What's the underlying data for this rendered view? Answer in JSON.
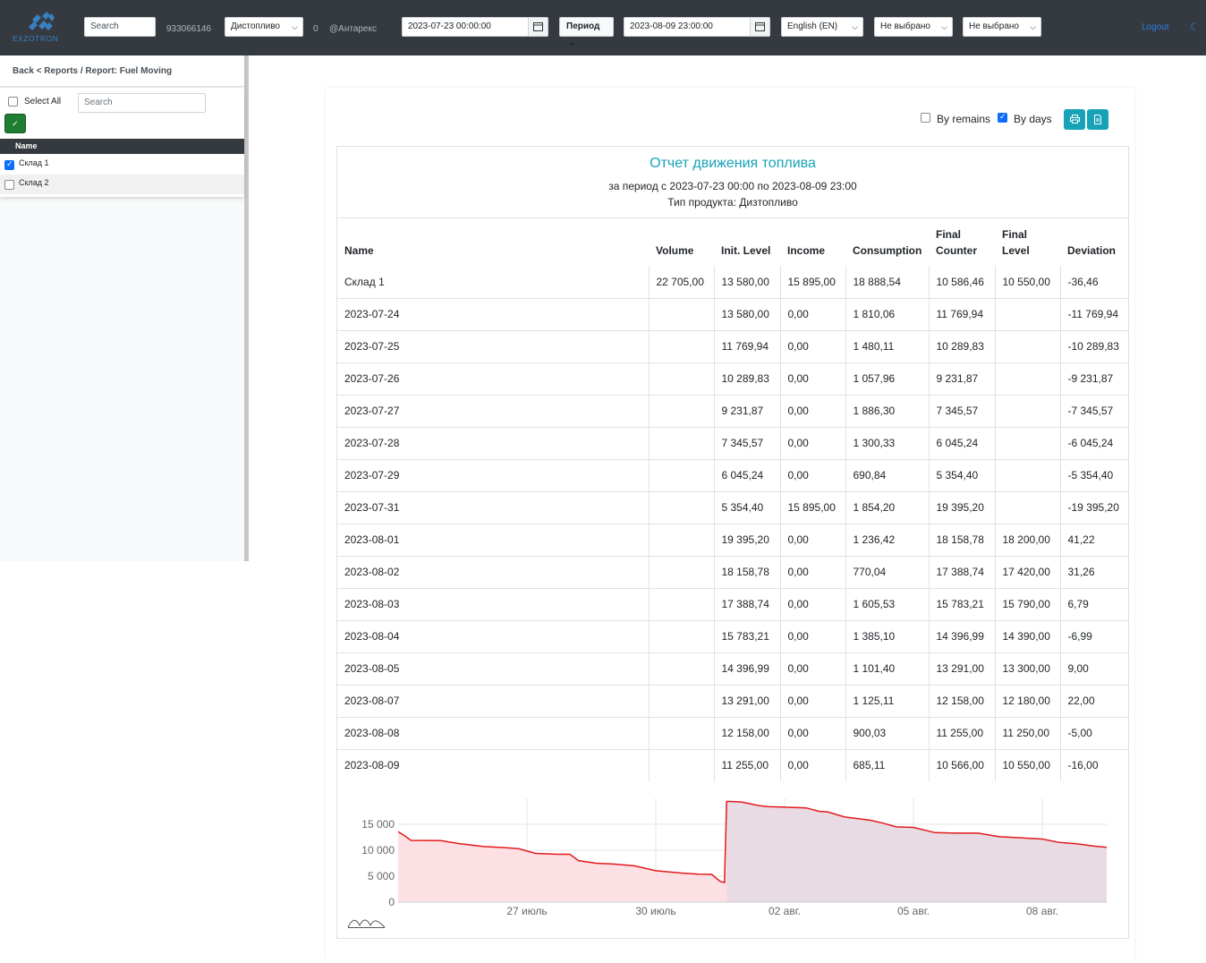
{
  "navbar": {
    "logo_text": "EXZOTRON",
    "search_placeholder": "Search",
    "phone": "933066146",
    "product_select": "Дистопливо",
    "count": "0",
    "company": "@Антарекс",
    "date_from": "2023-07-23 00:00:00",
    "period_button": "Период",
    "date_to": "2023-08-09 23:00:00",
    "language_select": "English (EN)",
    "filter1_select": "Не выбрано",
    "filter2_select": "Не выбрано",
    "logout": "Logout"
  },
  "sidebar": {
    "breadcrumb": "Back < Reports / Report: Fuel Moving",
    "select_all_label": "Select All",
    "search_placeholder": "Search",
    "column_header": "Name",
    "items": [
      {
        "label": "Склад 1",
        "checked": true
      },
      {
        "label": "Склад 2",
        "checked": false
      }
    ]
  },
  "options": {
    "by_remains_label": "By remains",
    "by_remains_checked": false,
    "by_days_label": "By days",
    "by_days_checked": true,
    "print_icon": "printer-icon",
    "export_icon": "file-excel-icon"
  },
  "report": {
    "title": "Отчет движения топлива",
    "period": "за период с 2023-07-23 00:00 по 2023-08-09 23:00",
    "product": "Тип продукта: Дизтопливо",
    "columns": [
      "Name",
      "Volume",
      "Init. Level",
      "Income",
      "Consumption",
      "Final Counter",
      "Final Level",
      "Deviation"
    ],
    "rows": [
      [
        "Склад 1",
        "22 705,00",
        "13 580,00",
        "15 895,00",
        "18 888,54",
        "10 586,46",
        "10 550,00",
        "-36,46"
      ],
      [
        "2023-07-24",
        "",
        "13 580,00",
        "0,00",
        "1 810,06",
        "11 769,94",
        "",
        "-11 769,94"
      ],
      [
        "2023-07-25",
        "",
        "11 769,94",
        "0,00",
        "1 480,11",
        "10 289,83",
        "",
        "-10 289,83"
      ],
      [
        "2023-07-26",
        "",
        "10 289,83",
        "0,00",
        "1 057,96",
        "9 231,87",
        "",
        "-9 231,87"
      ],
      [
        "2023-07-27",
        "",
        "9 231,87",
        "0,00",
        "1 886,30",
        "7 345,57",
        "",
        "-7 345,57"
      ],
      [
        "2023-07-28",
        "",
        "7 345,57",
        "0,00",
        "1 300,33",
        "6 045,24",
        "",
        "-6 045,24"
      ],
      [
        "2023-07-29",
        "",
        "6 045,24",
        "0,00",
        "690,84",
        "5 354,40",
        "",
        "-5 354,40"
      ],
      [
        "2023-07-31",
        "",
        "5 354,40",
        "15 895,00",
        "1 854,20",
        "19 395,20",
        "",
        "-19 395,20"
      ],
      [
        "2023-08-01",
        "",
        "19 395,20",
        "0,00",
        "1 236,42",
        "18 158,78",
        "18 200,00",
        "41,22"
      ],
      [
        "2023-08-02",
        "",
        "18 158,78",
        "0,00",
        "770,04",
        "17 388,74",
        "17 420,00",
        "31,26"
      ],
      [
        "2023-08-03",
        "",
        "17 388,74",
        "0,00",
        "1 605,53",
        "15 783,21",
        "15 790,00",
        "6,79"
      ],
      [
        "2023-08-04",
        "",
        "15 783,21",
        "0,00",
        "1 385,10",
        "14 396,99",
        "14 390,00",
        "-6,99"
      ],
      [
        "2023-08-05",
        "",
        "14 396,99",
        "0,00",
        "1 101,40",
        "13 291,00",
        "13 300,00",
        "9,00"
      ],
      [
        "2023-08-07",
        "",
        "13 291,00",
        "0,00",
        "1 125,11",
        "12 158,00",
        "12 180,00",
        "22,00"
      ],
      [
        "2023-08-08",
        "",
        "12 158,00",
        "0,00",
        "900,03",
        "11 255,00",
        "11 250,00",
        "-5,00"
      ],
      [
        "2023-08-09",
        "",
        "11 255,00",
        "0,00",
        "685,11",
        "10 566,00",
        "10 550,00",
        "-16,00"
      ]
    ]
  },
  "chart_data": {
    "type": "area",
    "ylim": [
      0,
      20000
    ],
    "yticks": [
      0,
      5000,
      10000,
      15000
    ],
    "ytick_labels": [
      "0",
      "5 000",
      "10 000",
      "15 000"
    ],
    "xtick_labels": [
      "27 июль",
      "30 июль",
      "02 авг.",
      "05 авг.",
      "08 авг."
    ],
    "x_range_days": [
      0,
      16.5
    ],
    "xtick_positions_days": [
      3.0,
      6.0,
      9.0,
      12.0,
      15.0
    ],
    "series": [
      {
        "color": "#e31a1c",
        "fill_before": "#fde0e3",
        "fill_after": "#e8dbe3",
        "points": [
          [
            0.0,
            13580
          ],
          [
            0.15,
            12800
          ],
          [
            0.3,
            11900
          ],
          [
            1.0,
            11850
          ],
          [
            1.4,
            11300
          ],
          [
            2.0,
            10700
          ],
          [
            2.5,
            10500
          ],
          [
            2.8,
            10289
          ],
          [
            3.2,
            9400
          ],
          [
            3.5,
            9300
          ],
          [
            3.7,
            9231
          ],
          [
            4.0,
            9231
          ],
          [
            4.2,
            8000
          ],
          [
            4.6,
            7500
          ],
          [
            5.0,
            7345
          ],
          [
            5.5,
            7000
          ],
          [
            6.0,
            6045
          ],
          [
            6.6,
            5600
          ],
          [
            7.0,
            5400
          ],
          [
            7.3,
            5354
          ],
          [
            7.5,
            4000
          ],
          [
            7.6,
            3800
          ],
          [
            7.65,
            19395
          ],
          [
            7.75,
            19395
          ],
          [
            8.0,
            19300
          ],
          [
            8.4,
            18600
          ],
          [
            8.6,
            18400
          ],
          [
            9.0,
            18300
          ],
          [
            9.5,
            18158
          ],
          [
            9.8,
            17500
          ],
          [
            10.0,
            17388
          ],
          [
            10.4,
            16400
          ],
          [
            10.8,
            16000
          ],
          [
            11.0,
            15783
          ],
          [
            11.3,
            15200
          ],
          [
            11.6,
            14500
          ],
          [
            12.0,
            14396
          ],
          [
            12.5,
            13400
          ],
          [
            13.0,
            13300
          ],
          [
            13.5,
            13291
          ],
          [
            14.0,
            12600
          ],
          [
            14.5,
            12400
          ],
          [
            15.0,
            12158
          ],
          [
            15.4,
            11500
          ],
          [
            15.8,
            11255
          ],
          [
            16.2,
            10800
          ],
          [
            16.5,
            10566
          ]
        ]
      }
    ]
  }
}
